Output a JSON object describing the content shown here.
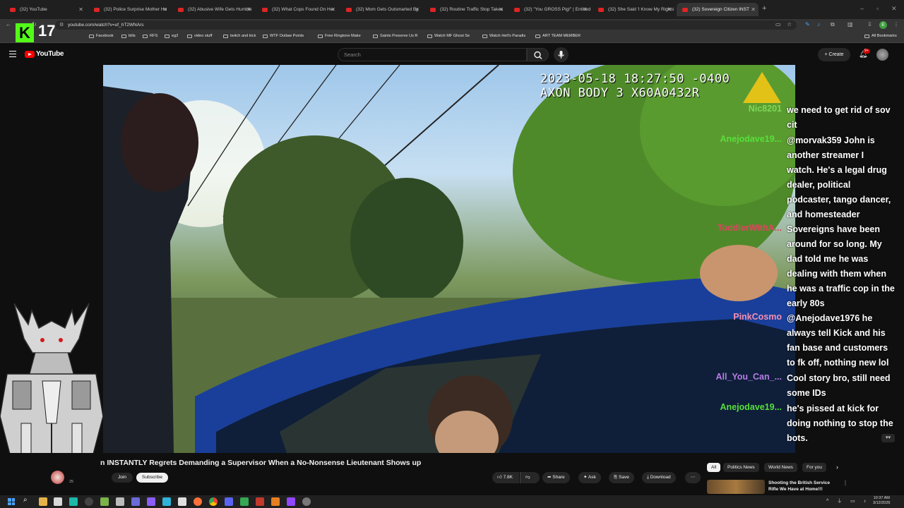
{
  "browser": {
    "tabs": [
      {
        "title": "(32) YouTube",
        "active": false
      },
      {
        "title": "(32) Police Surprise Mother Ho",
        "active": false
      },
      {
        "title": "(32) Abusive Wife Gets Humble",
        "active": false
      },
      {
        "title": "(32) What Cops Found On Her",
        "active": false
      },
      {
        "title": "(32) Mom Gets Outsmarted By",
        "active": false
      },
      {
        "title": "(32) Routine Traffic Stop Takes",
        "active": false
      },
      {
        "title": "(32) \"You GROSS Pig!\" | Entitled",
        "active": false
      },
      {
        "title": "(32) She Said 'I Know My Rights'",
        "active": false
      },
      {
        "title": "(32) Sovereign Citizen INST",
        "active": true
      }
    ],
    "url": "youtube.com/watch?v=uf_hT2WNArs",
    "bookmarks": [
      "Facebook",
      "bills",
      "RFS",
      "eg2",
      "video stuff",
      "twitch and kick",
      "WTF Outlaw Points",
      "Free Ringtone Make",
      "Saints Preserve Us R",
      "Watch MF Ghost Se",
      "Watch Hell's Paradis",
      "ART TEAM MEMBER"
    ],
    "all_bookmarks": "All Bookmarks",
    "profile_initial": "E"
  },
  "youtube": {
    "logo": "YouTube",
    "search_placeholder": "Search",
    "create_label": "Create",
    "notif_count": "9+"
  },
  "stream": {
    "viewer_count": "17",
    "kick_letter": "K"
  },
  "video": {
    "timestamp": "2023-05-18 18:27:50 -0400",
    "device": "AXON BODY 3 X60A0432R",
    "title": "n INSTANTLY Regrets Demanding a Supervisor When a No-Nonsense Lieutenant Shows up",
    "subscriber_fragment": "25"
  },
  "chat": [
    {
      "user": "Nic8201",
      "color": "#7ed957",
      "lines": [
        "we need to get rid of sov",
        "cit"
      ]
    },
    {
      "user": "Anejodave19...",
      "color": "#57e039",
      "lines": [
        "@morvak359 John is",
        "another streamer I",
        "watch. He's a legal drug",
        "dealer, political",
        "podcaster, tango dancer,",
        "and homesteader"
      ]
    },
    {
      "user": "ToddlerWithA...",
      "color": "#e0445f",
      "lines": [
        "Sovereigns have been",
        "around for so long. My",
        "dad told me he was",
        "dealing with them when",
        "he was a traffic cop in the",
        "early 80s"
      ]
    },
    {
      "user": "PinkCosmo",
      "color": "#f58fb0",
      "lines": [
        "@Anejodave1976 he",
        "always tell Kick and his",
        "fan base and customers",
        "to fk off, nothing new lol"
      ]
    },
    {
      "user": "All_You_Can_...",
      "color": "#b77de6",
      "lines": [
        "Cool story bro, still need",
        "some IDs"
      ]
    },
    {
      "user": "Anejodave19...",
      "color": "#57e039",
      "lines": [
        "he's pissed at kick for",
        "doing nothing to stop the",
        "bots."
      ]
    }
  ],
  "actions": {
    "join": "Join",
    "subscribe": "Subscribe",
    "likes": "7.8K",
    "share": "Share",
    "ask": "Ask",
    "save": "Save",
    "download": "Download"
  },
  "chips": [
    "All",
    "Politics News",
    "World News",
    "For you"
  ],
  "recommendation": {
    "title": "Shooting the British Service Rifle We Have at Home!!!"
  },
  "taskbar": {
    "time": "10:37 AM",
    "date": "3/12/2026"
  }
}
